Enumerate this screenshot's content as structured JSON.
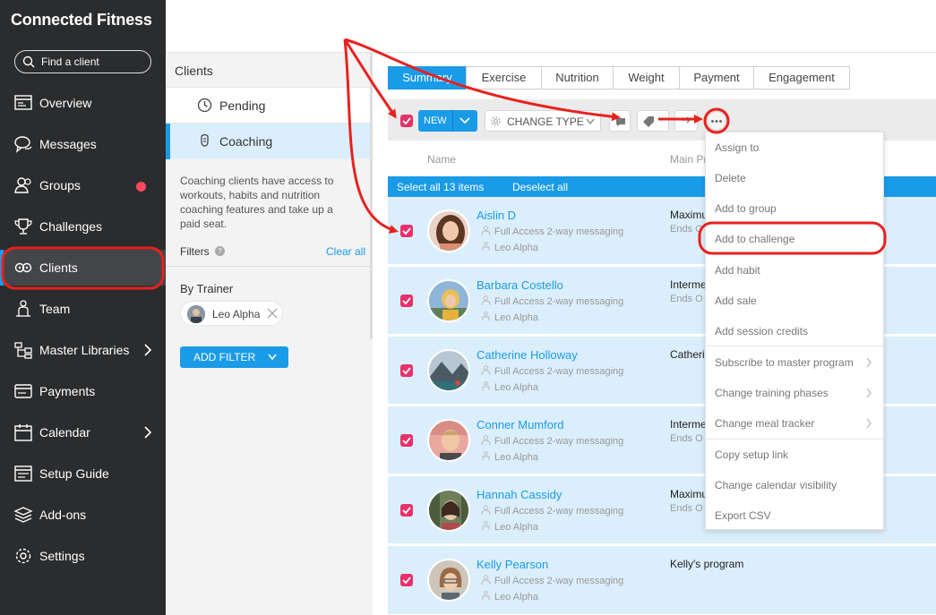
{
  "sidebar": {
    "brand": "Connected Fitness",
    "search_placeholder": "Find a client",
    "items": [
      {
        "label": "Overview"
      },
      {
        "label": "Messages"
      },
      {
        "label": "Groups"
      },
      {
        "label": "Challenges"
      },
      {
        "label": "Clients"
      },
      {
        "label": "Team"
      },
      {
        "label": "Master Libraries"
      },
      {
        "label": "Payments"
      },
      {
        "label": "Calendar"
      },
      {
        "label": "Setup Guide"
      },
      {
        "label": "Add-ons"
      },
      {
        "label": "Settings"
      }
    ]
  },
  "middle": {
    "title": "Clients",
    "statuses": [
      {
        "label": "Pending"
      },
      {
        "label": "Coaching"
      }
    ],
    "description": "Coaching clients have access to workouts, habits and nutrition coaching features and take up a paid seat.",
    "filters_label": "Filters",
    "clear_all": "Clear all",
    "by_trainer": "By Trainer",
    "trainer_chip": "Leo Alpha",
    "add_filter": "ADD FILTER"
  },
  "tabs": [
    "Summary",
    "Exercise",
    "Nutrition",
    "Weight",
    "Payment",
    "Engagement"
  ],
  "toolbar": {
    "new_label": "NEW",
    "change_type_label": "CHANGE TYPE"
  },
  "columns": {
    "name": "Name",
    "program": "Main Pr"
  },
  "selection": {
    "select_all": "Select all 13 items",
    "deselect_all": "Deselect all"
  },
  "clients": [
    {
      "name": "Aislin D",
      "access": "Full Access 2-way messaging",
      "trainer": "Leo Alpha",
      "program": "Maximu",
      "ends": "Ends O"
    },
    {
      "name": "Barbara Costello",
      "access": "Full Access 2-way messaging",
      "trainer": "Leo Alpha",
      "program": "Interme",
      "ends": "Ends O"
    },
    {
      "name": "Catherine Holloway",
      "access": "Full Access 2-way messaging",
      "trainer": "Leo Alpha",
      "program": "Catheri",
      "ends": ""
    },
    {
      "name": "Conner Mumford",
      "access": "Full Access 2-way messaging",
      "trainer": "Leo Alpha",
      "program": "Interme",
      "ends": "Ends O"
    },
    {
      "name": "Hannah Cassidy",
      "access": "Full Access 2-way messaging",
      "trainer": "Leo Alpha",
      "program": "Maximu",
      "ends": "Ends O"
    },
    {
      "name": "Kelly Pearson",
      "access": "Full Access 2-way messaging",
      "trainer": "Leo Alpha",
      "program": "Kelly's program",
      "ends": ""
    }
  ],
  "menu": [
    {
      "label": "Assign to"
    },
    {
      "label": "Delete"
    },
    {
      "label": "Add to group"
    },
    {
      "label": "Add to challenge"
    },
    {
      "label": "Add habit"
    },
    {
      "label": "Add sale"
    },
    {
      "label": "Add session credits"
    },
    {
      "label": "Subscribe to master program"
    },
    {
      "label": "Change training phases"
    },
    {
      "label": "Change meal tracker"
    },
    {
      "label": "Copy setup link"
    },
    {
      "label": "Change calendar visibility"
    },
    {
      "label": "Export CSV"
    }
  ],
  "colors": {
    "accent": "#1a9be8",
    "sidebar": "#2b2c2e",
    "checkbox": "#e8306a",
    "annotation": "#e8211f"
  }
}
